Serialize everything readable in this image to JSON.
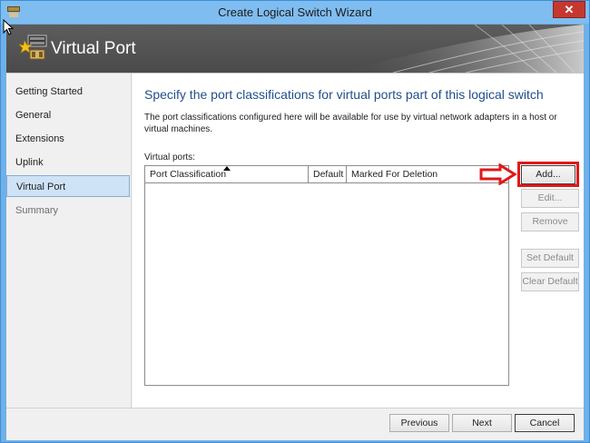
{
  "window": {
    "title": "Create Logical Switch Wizard",
    "close_label": "✕"
  },
  "banner": {
    "title": "Virtual Port"
  },
  "nav": {
    "items": [
      {
        "label": "Getting Started",
        "state": "normal"
      },
      {
        "label": "General",
        "state": "normal"
      },
      {
        "label": "Extensions",
        "state": "normal"
      },
      {
        "label": "Uplink",
        "state": "normal"
      },
      {
        "label": "Virtual Port",
        "state": "active"
      },
      {
        "label": "Summary",
        "state": "muted"
      }
    ]
  },
  "content": {
    "heading": "Specify the port classifications for virtual ports part of this logical switch",
    "description": "The port classifications configured here will be available for use by virtual network adapters in a host or virtual machines.",
    "grid_label": "Virtual ports:",
    "columns": [
      "Port Classification",
      "Default",
      "Marked For Deletion"
    ],
    "rows": []
  },
  "buttons": {
    "add": "Add...",
    "edit": "Edit...",
    "remove": "Remove",
    "set_default": "Set Default",
    "clear_default": "Clear Default"
  },
  "footer": {
    "previous": "Previous",
    "next": "Next",
    "cancel": "Cancel"
  },
  "colors": {
    "highlight": "#e01818",
    "heading": "#1f4f8c",
    "titlebar": "#7fbdf0"
  }
}
